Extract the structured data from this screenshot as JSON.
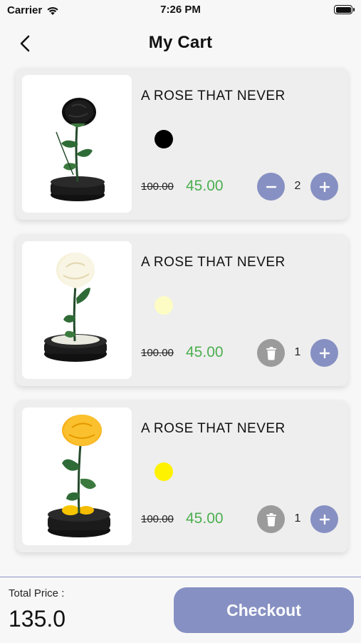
{
  "status_bar": {
    "carrier": "Carrier",
    "time": "7:26 PM"
  },
  "header": {
    "title": "My Cart"
  },
  "cart": {
    "items": [
      {
        "title": "A ROSE THAT NEVER",
        "color": "#000000",
        "old_price": "100.00",
        "price": "45.00",
        "quantity": "2",
        "flower": "black-rose",
        "left_control": "minus"
      },
      {
        "title": "A ROSE THAT NEVER",
        "color": "#fdfcc4",
        "old_price": "100.00",
        "price": "45.00",
        "quantity": "1",
        "flower": "white-rose",
        "left_control": "trash"
      },
      {
        "title": "A ROSE THAT NEVER",
        "color": "#fff200",
        "old_price": "100.00",
        "price": "45.00",
        "quantity": "1",
        "flower": "yellow-rose",
        "left_control": "trash"
      }
    ]
  },
  "footer": {
    "total_label": "Total Price :",
    "total_value": "135.0",
    "checkout_label": "Checkout"
  },
  "colors": {
    "accent": "#8690c2",
    "price_green": "#4caf50",
    "trash_gray": "#9b9b9b"
  }
}
